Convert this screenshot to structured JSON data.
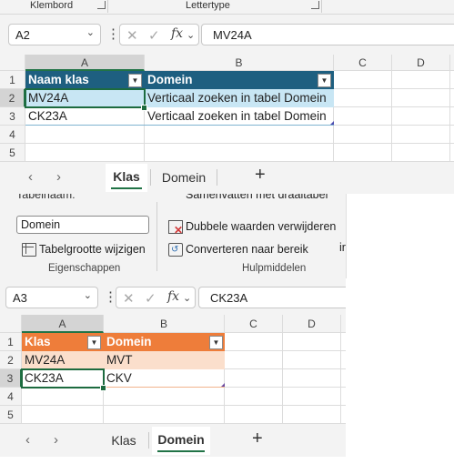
{
  "ribbon_top": {
    "group1": "Klembord",
    "group2": "Lettertype"
  },
  "workbook1": {
    "namebox": "A2",
    "formula": "MV24A",
    "columns": [
      "A",
      "B",
      "C",
      "D"
    ],
    "rows": [
      "1",
      "2",
      "3",
      "4",
      "5"
    ],
    "table_header": [
      "Naam klas",
      "Domein"
    ],
    "table_rows": [
      [
        "MV24A",
        "Verticaal zoeken in tabel Domein"
      ],
      [
        "CK23A",
        "Verticaal zoeken in tabel Domein"
      ]
    ],
    "tabs": [
      "Klas",
      "Domein"
    ],
    "active_tab": "Klas",
    "colors": {
      "header_fill": "#1e5f80",
      "band_fill": "#c8e6f4"
    }
  },
  "ribbon_mid": {
    "table_name_label": "Tabelnaam:",
    "table_name_value": "Domein",
    "resize_label": "Tabelgrootte wijzigen",
    "properties_group": "Eigenschappen",
    "summarize_label": "Samenvatten met draaitabel",
    "remove_dupes_label": "Dubbele waarden verwijderen",
    "convert_label": "Converteren naar bereik",
    "tools_group": "Hulpmiddelen",
    "cut_text": "ir"
  },
  "workbook2": {
    "namebox": "A3",
    "formula": "CK23A",
    "columns": [
      "A",
      "B",
      "C",
      "D"
    ],
    "rows": [
      "1",
      "2",
      "3",
      "4",
      "5"
    ],
    "table_header": [
      "Klas",
      "Domein"
    ],
    "table_rows": [
      [
        "MV24A",
        "MVT"
      ],
      [
        "CK23A",
        "CKV"
      ]
    ],
    "tabs": [
      "Klas",
      "Domein"
    ],
    "active_tab": "Domein",
    "colors": {
      "header_fill": "#ee7d3a",
      "band_fill": "#fbdfcc"
    }
  },
  "icons": {
    "chevron": "⌄",
    "more": "⋮",
    "cancel": "✕",
    "confirm": "✓",
    "fx": "fx",
    "prev": "‹",
    "next": "›",
    "add": "+",
    "filter": "▼"
  }
}
